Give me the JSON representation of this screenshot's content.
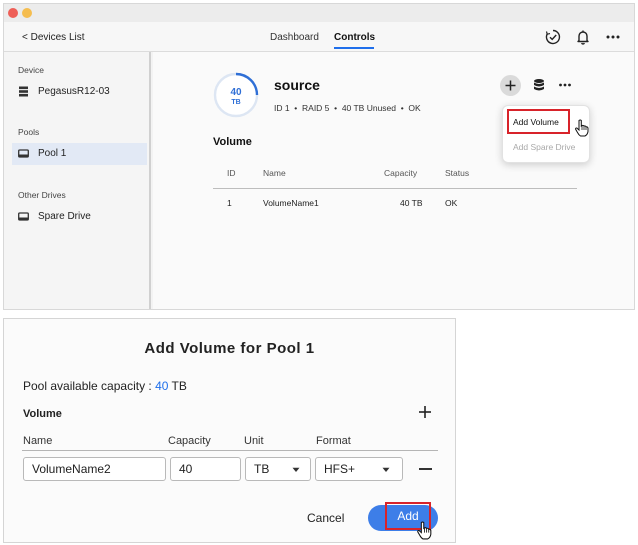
{
  "window": {
    "back_label": "< Devices List",
    "tabs": [
      {
        "label": "Dashboard",
        "active": false
      },
      {
        "label": "Controls",
        "active": true
      }
    ],
    "icons": [
      "schedule-check-icon",
      "bell-icon",
      "more-horizontal-icon"
    ]
  },
  "sidebar": {
    "device_header": "Device",
    "device_name": "PegasusR12-03",
    "pools_header": "Pools",
    "pool_name": "Pool 1",
    "other_header": "Other Drives",
    "spare_name": "Spare Drive"
  },
  "pool": {
    "capacity_value": "40",
    "capacity_unit": "TB",
    "name": "source",
    "meta": "ID 1  •  RAID 5  •  40 TB Unused  •  OK",
    "section_title": "Volume",
    "columns": [
      "ID",
      "Name",
      "Capacity",
      "Status"
    ],
    "rows": [
      {
        "id": "1",
        "name": "VolumeName1",
        "capacity": "40 TB",
        "status": "OK"
      }
    ]
  },
  "menu": {
    "items": [
      {
        "label": "Add Volume",
        "enabled": true
      },
      {
        "label": "Add Spare Drive",
        "enabled": false
      }
    ]
  },
  "dialog": {
    "title": "Add Volume for Pool 1",
    "capacity_label": "Pool available capacity : ",
    "capacity_value": "40",
    "capacity_unit": " TB",
    "volume_header": "Volume",
    "columns": [
      "Name",
      "Capacity",
      "Unit",
      "Format"
    ],
    "row": {
      "name": "VolumeName2",
      "capacity": "40",
      "unit": "TB",
      "format": "HFS+"
    },
    "cancel_label": "Cancel",
    "add_label": "Add"
  },
  "colors": {
    "accent": "#1f6feb",
    "button": "#3d7ee8",
    "highlight": "#d8232a"
  }
}
